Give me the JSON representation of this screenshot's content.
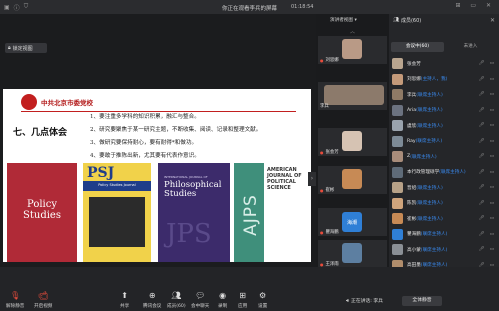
{
  "window": {
    "title": "你正在观看李兵的屏幕",
    "time": "01:18:54"
  },
  "share": {
    "lock_button": "锁定视图"
  },
  "slide": {
    "org": "中共北京市委党校",
    "heading": "七、几点体会",
    "points": [
      "1、要注重多学科的知识积累，融汇与整合。",
      "2、研究要聚焦于某一研究主题，不断收集、阅读、记录和整理文献。",
      "3、做研究要保持耐心，要有耐得*和做功。",
      "4、要敢于推陈出新，尤其要有代表作意识。"
    ],
    "covers": [
      {
        "title": "Policy Studies"
      },
      {
        "title": "PSJ",
        "subtitle": "Policy Studies Journal"
      },
      {
        "title": "Philosophical Studies",
        "subtitle": "INTERNATIONAL JOURNAL OF",
        "watermark": "JPS"
      },
      {
        "title": "AMERICAN JOURNAL OF POLITICAL SCIENCE",
        "watermark": "AJPS"
      }
    ]
  },
  "video": {
    "layout_label": "演讲者视图",
    "tiles": [
      {
        "name": "刘思娜"
      },
      {
        "name": "李兵"
      },
      {
        "name": "张会芳"
      },
      {
        "name": "崔彬"
      },
      {
        "name": "瞿海鹏",
        "badge": "海潮"
      },
      {
        "name": "王泽雨"
      }
    ]
  },
  "panel": {
    "title": "成员(60)",
    "tabs": [
      "会议中(60)",
      "未进入"
    ],
    "members": [
      {
        "name": "张会芳",
        "role": ""
      },
      {
        "name": "刘思娜",
        "role": "(主持人，我)"
      },
      {
        "name": "李兵",
        "role": "(联席主持人)"
      },
      {
        "name": "Aria",
        "role": "(联席主持人)"
      },
      {
        "name": "虞欣",
        "role": "(联席主持人)"
      },
      {
        "name": "Ray",
        "role": "(联席主持人)"
      },
      {
        "name": "Z",
        "role": "(联席主持人)"
      },
      {
        "name": "本行政管理硕学",
        "role": "(联席主持人)"
      },
      {
        "name": "晋绍",
        "role": "(联席主持人)"
      },
      {
        "name": "陈凯",
        "role": "(联席主持人)"
      },
      {
        "name": "崔彬",
        "role": "(联席主持人)"
      },
      {
        "name": "瞿海鹏",
        "role": "(联席主持人)"
      },
      {
        "name": "高小蒙",
        "role": "(联席主持人)"
      },
      {
        "name": "高田墨",
        "role": "(联席主持人)"
      }
    ]
  },
  "toolbar": {
    "buttons": [
      {
        "label": "解除静音",
        "icon": "mic-muted-icon"
      },
      {
        "label": "开启视频",
        "icon": "camera-off-icon"
      },
      {
        "label": "共享",
        "icon": "share-screen-icon"
      },
      {
        "label": "腾讯会议",
        "icon": "meeting-app-icon"
      },
      {
        "label": "成员(60)",
        "icon": "members-icon"
      },
      {
        "label": "会中聊天",
        "icon": "chat-icon"
      },
      {
        "label": "录制",
        "icon": "record-icon"
      },
      {
        "label": "应用",
        "icon": "apps-icon"
      },
      {
        "label": "设置",
        "icon": "settings-icon"
      }
    ],
    "speaking_label": "正在讲话: 李兵",
    "mute_all": "全体静音"
  }
}
